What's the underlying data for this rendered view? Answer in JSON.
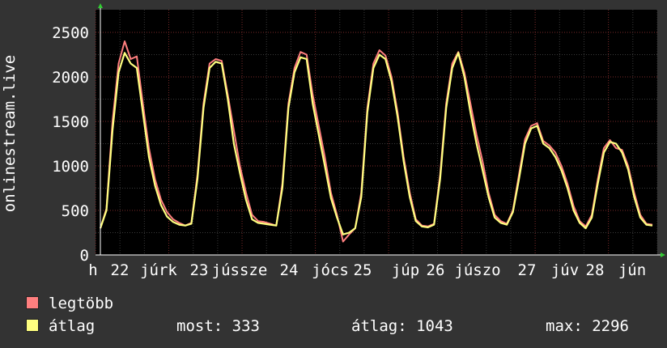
{
  "chart_data": {
    "type": "line",
    "title": "",
    "xlabel": "",
    "ylabel": "onlinestream.live",
    "ylim": [
      0,
      2500
    ],
    "yticks": [
      0,
      500,
      1000,
      1500,
      2000,
      2500
    ],
    "x_tick_labels": [
      "h",
      "22",
      "júrk",
      "23",
      "jússze",
      "24",
      "jócs",
      "25",
      "júp",
      "26",
      "júszo",
      "27",
      "júv",
      "28",
      "jún"
    ],
    "grid": true,
    "legend": "bottom-left",
    "series": [
      {
        "name": "legtöbb",
        "color": "#ff7f7f",
        "values": [
          300,
          520,
          1500,
          2150,
          2400,
          2200,
          2230,
          1700,
          1200,
          850,
          620,
          480,
          400,
          360,
          330,
          360,
          900,
          1700,
          2150,
          2200,
          2180,
          1800,
          1400,
          1000,
          700,
          450,
          380,
          370,
          350,
          330,
          800,
          1700,
          2100,
          2280,
          2250,
          1800,
          1450,
          1100,
          700,
          450,
          150,
          230,
          300,
          700,
          1650,
          2150,
          2300,
          2240,
          2000,
          1600,
          1100,
          700,
          400,
          330,
          320,
          350,
          900,
          1700,
          2150,
          2280,
          2050,
          1700,
          1350,
          1050,
          700,
          450,
          380,
          350,
          500,
          900,
          1300,
          1450,
          1480,
          1280,
          1230,
          1150,
          1000,
          800,
          550,
          380,
          320,
          450,
          850,
          1200,
          1290,
          1200,
          1180,
          1000,
          700,
          450,
          350,
          340
        ]
      },
      {
        "name": "átlag",
        "color": "#ffff80",
        "values": [
          300,
          500,
          1400,
          2050,
          2270,
          2150,
          2100,
          1600,
          1100,
          780,
          560,
          430,
          370,
          340,
          330,
          350,
          850,
          1650,
          2100,
          2170,
          2150,
          1750,
          1250,
          920,
          620,
          400,
          360,
          350,
          340,
          330,
          750,
          1650,
          2050,
          2220,
          2200,
          1700,
          1350,
          1000,
          640,
          420,
          230,
          250,
          300,
          650,
          1600,
          2100,
          2250,
          2200,
          1950,
          1550,
          1050,
          650,
          380,
          320,
          310,
          340,
          850,
          1650,
          2100,
          2270,
          2000,
          1600,
          1250,
          950,
          650,
          420,
          360,
          340,
          480,
          850,
          1250,
          1420,
          1450,
          1250,
          1200,
          1100,
          950,
          750,
          500,
          360,
          300,
          420,
          800,
          1150,
          1270,
          1250,
          1150,
          960,
          650,
          420,
          340,
          330
        ]
      }
    ]
  },
  "legend": {
    "items": [
      {
        "label": "legtöbb",
        "color": "#ff7f7f"
      },
      {
        "label": "átlag",
        "color": "#ffff80"
      }
    ],
    "stats": {
      "now_label": "most:",
      "now_value": "333",
      "avg_label": "átlag:",
      "avg_value": "1043",
      "max_label": "max:",
      "max_value": "2296"
    }
  }
}
